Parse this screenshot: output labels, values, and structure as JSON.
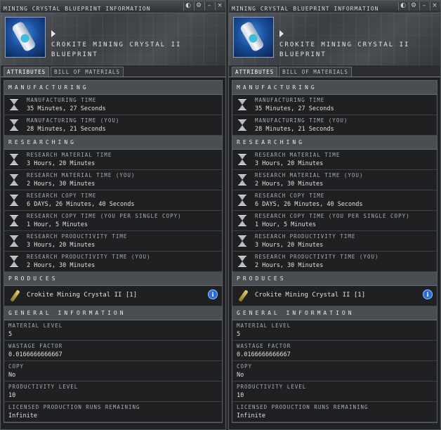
{
  "windows": [
    {
      "title": "MINING CRYSTAL BLUEPRINT INFORMATION",
      "item_name_line1": "CROKITE MINING CRYSTAL II BLUEPRINT",
      "item_name_line2": "",
      "tabs": [
        "ATTRIBUTES",
        "BILL OF MATERIALS"
      ]
    },
    {
      "title": "MINING CRYSTAL BLUEPRINT INFORMATION",
      "item_name_line1": "CROKITE MINING CRYSTAL II",
      "item_name_line2": "BLUEPRINT",
      "tabs": [
        "ATTRIBUTES",
        "BILL OF MATERIALS"
      ]
    }
  ],
  "title_buttons": {
    "pin": "◐",
    "settings": "⚙",
    "minimize": "–",
    "close": "×"
  },
  "sections": {
    "manufacturing": "MANUFACTURING",
    "researching": "RESEARCHING",
    "produces": "PRODUCES",
    "general": "GENERAL INFORMATION"
  },
  "manufacturing_rows": [
    {
      "label": "MANUFACTURING TIME",
      "value": "35 Minutes, 27 Seconds"
    },
    {
      "label": "MANUFACTURING TIME (YOU)",
      "value": "28 Minutes, 21 Seconds"
    }
  ],
  "research_rows": [
    {
      "label": "RESEARCH MATERIAL TIME",
      "value": "3 Hours, 20 Minutes"
    },
    {
      "label": "RESEARCH MATERIAL TIME (YOU)",
      "value": "2 Hours, 30 Minutes"
    },
    {
      "label": "RESEARCH COPY TIME",
      "value": "6 DAYS, 26 Minutes, 40 Seconds"
    },
    {
      "label": "RESEARCH COPY TIME (YOU PER SINGLE COPY)",
      "value": "1 Hour, 5 Minutes"
    },
    {
      "label": "RESEARCH PRODUCTIVITY TIME",
      "value": "3 Hours, 20 Minutes"
    },
    {
      "label": "RESEARCH PRODUCTIVITY TIME (YOU)",
      "value": "2 Hours, 30 Minutes"
    }
  ],
  "produces": {
    "text": "Crokite Mining Crystal II [1]",
    "info_glyph": "i"
  },
  "general_rows": [
    {
      "label": "MATERIAL LEVEL",
      "value": "5"
    },
    {
      "label": "WASTAGE FACTOR",
      "value": "0.0166666666667"
    },
    {
      "label": "COPY",
      "value": "No"
    },
    {
      "label": "PRODUCTIVITY LEVEL",
      "value": "10"
    },
    {
      "label": "LICENSED PRODUCTION RUNS REMAINING",
      "value": "Infinite"
    }
  ],
  "colors": {
    "accent": "#2a6cd6",
    "section_bg": "#4a4d51",
    "row_bg": "#1e2022"
  }
}
